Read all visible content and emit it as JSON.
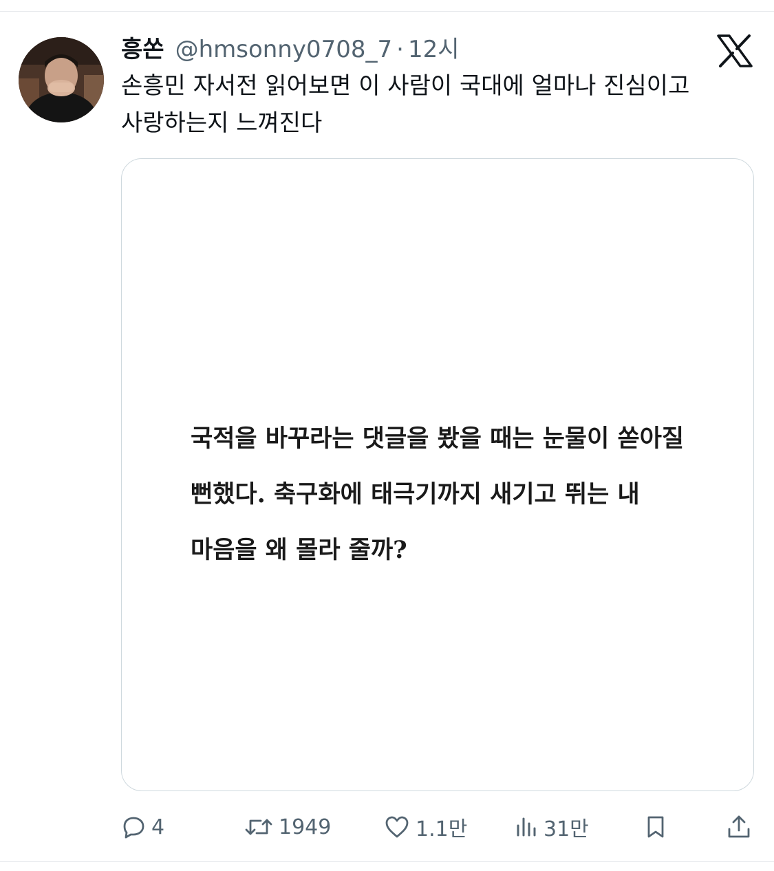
{
  "tweet": {
    "display_name": "흥쏜",
    "handle": "@hmsonny0708_7",
    "separator": "·",
    "timestamp": "12시",
    "text": "손흥민 자서전 읽어보면 이 사람이 국대에 얼마나 진심이고 사랑하는지 느껴진다"
  },
  "media": {
    "quote_text": "국적을 바꾸라는 댓글을 봤을 때는 눈물이 쏟아질 뻔했다. 축구화에 태극기까지 새기고 뛰는 내 마음을 왜 몰라 줄까?"
  },
  "actions": {
    "replies": "4",
    "retweets": "1949",
    "likes": "1.1만",
    "views": "31만"
  },
  "icons": {
    "brand": "x-logo-icon",
    "reply": "reply-icon",
    "retweet": "retweet-icon",
    "like": "heart-icon",
    "views": "views-icon",
    "bookmark": "bookmark-icon",
    "share": "share-icon"
  },
  "colors": {
    "text_primary": "#0f1419",
    "text_secondary": "#536471",
    "border": "#cfd9de"
  }
}
